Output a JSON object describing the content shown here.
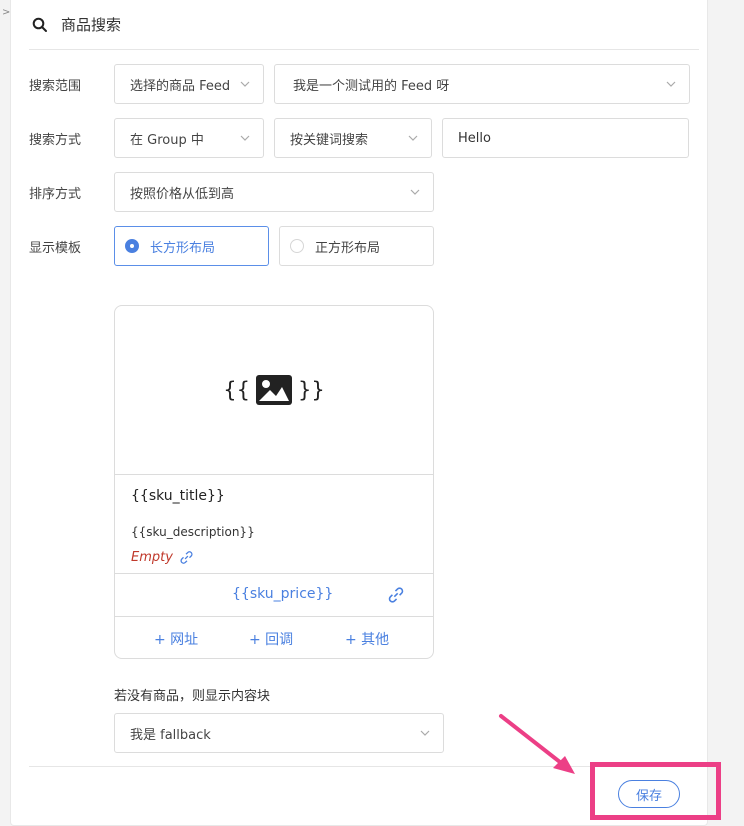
{
  "colors": {
    "accent": "#4a80e0",
    "annotation": "#ec3f86",
    "empty": "#c0392b"
  },
  "header": {
    "icon": "search-icon",
    "title": "商品搜索"
  },
  "search_scope": {
    "label": "搜索范围",
    "scope_select": "选择的商品 Feed",
    "feed_select": "我是一个测试用的 Feed 呀"
  },
  "search_method": {
    "label": "搜索方式",
    "group_select": "在 Group 中",
    "method_select": "按关键词搜索",
    "keyword_value": "Hello"
  },
  "sort": {
    "label": "排序方式",
    "sort_select": "按照价格从低到高"
  },
  "template": {
    "label": "显示模板",
    "options": [
      {
        "label": "长方形布局",
        "selected": true
      },
      {
        "label": "正方形布局",
        "selected": false
      }
    ]
  },
  "card": {
    "image_open": "{{",
    "image_icon": "image-icon",
    "image_close": "}}",
    "sku_title": "{{sku_title}}",
    "sku_description": "{{sku_description}}",
    "empty_text": "Empty",
    "sku_price": "{{sku_price}}",
    "actions": [
      "+ 网址",
      "+ 回调",
      "+ 其他"
    ]
  },
  "fallback": {
    "label": "若没有商品，则显示内容块",
    "select": "我是 fallback"
  },
  "footer": {
    "save_label": "保存"
  },
  "annotation": {
    "arrow_icon": "arrow-icon",
    "highlight": "save-button-highlight"
  }
}
